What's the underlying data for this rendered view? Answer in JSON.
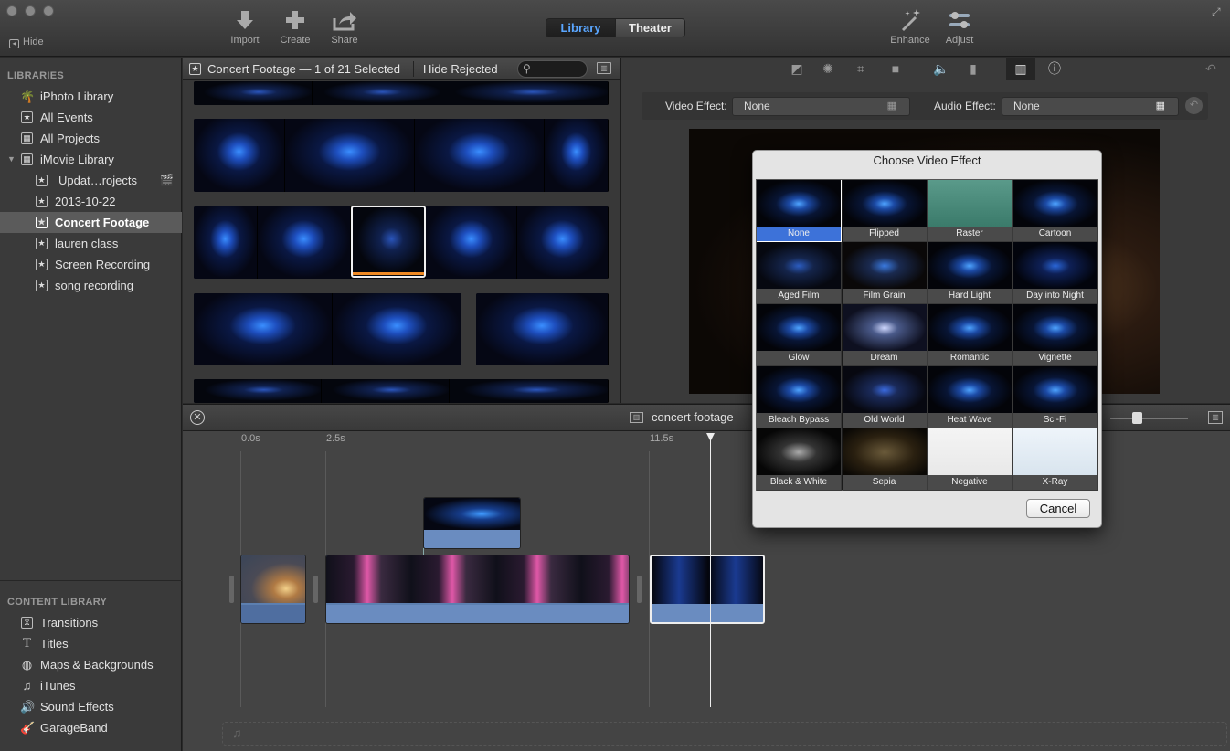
{
  "toolbar": {
    "hide_label": "Hide",
    "import_label": "Import",
    "create_label": "Create",
    "share_label": "Share",
    "enhance_label": "Enhance",
    "adjust_label": "Adjust",
    "seg_library": "Library",
    "seg_theater": "Theater"
  },
  "sidebar": {
    "libraries_header": "LIBRARIES",
    "items": [
      {
        "label": "iPhoto Library",
        "icon": "palm-icon"
      },
      {
        "label": "All Events",
        "icon": "star-icon"
      },
      {
        "label": "All Projects",
        "icon": "grid-icon"
      },
      {
        "label": "iMovie Library",
        "icon": "grid-icon"
      },
      {
        "label": "Updat…rojects",
        "icon": "star-icon"
      },
      {
        "label": "2013-10-22",
        "icon": "star-icon"
      },
      {
        "label": "Concert Footage",
        "icon": "star-icon"
      },
      {
        "label": "lauren class",
        "icon": "star-icon"
      },
      {
        "label": "Screen Recording",
        "icon": "star-icon"
      },
      {
        "label": "song recording",
        "icon": "star-icon"
      }
    ],
    "content_header": "CONTENT LIBRARY",
    "content_items": [
      {
        "label": "Transitions",
        "icon": "transitions-icon"
      },
      {
        "label": "Titles",
        "icon": "titles-icon"
      },
      {
        "label": "Maps & Backgrounds",
        "icon": "globe-icon"
      },
      {
        "label": "iTunes",
        "icon": "music-note-icon"
      },
      {
        "label": "Sound Effects",
        "icon": "speaker-icon"
      },
      {
        "label": "GarageBand",
        "icon": "guitar-icon"
      }
    ]
  },
  "browser": {
    "title": "Concert Footage — 1 of 21 Selected",
    "filter": "Hide Rejected"
  },
  "viewer": {
    "video_effect_label": "Video Effect:",
    "video_effect_value": "None",
    "audio_effect_label": "Audio Effect:",
    "audio_effect_value": "None"
  },
  "timeline": {
    "project_name": "concert footage",
    "ticks": [
      "0.0s",
      "2.5s",
      "11.5s"
    ]
  },
  "dialog": {
    "title": "Choose Video Effect",
    "cancel_label": "Cancel",
    "effects": [
      "None",
      "Flipped",
      "Raster",
      "Cartoon",
      "Aged Film",
      "Film Grain",
      "Hard Light",
      "Day into Night",
      "Glow",
      "Dream",
      "Romantic",
      "Vignette",
      "Bleach Bypass",
      "Old World",
      "Heat Wave",
      "Sci-Fi",
      "Black & White",
      "Sepia",
      "Negative",
      "X-Ray"
    ],
    "selected": "None"
  }
}
